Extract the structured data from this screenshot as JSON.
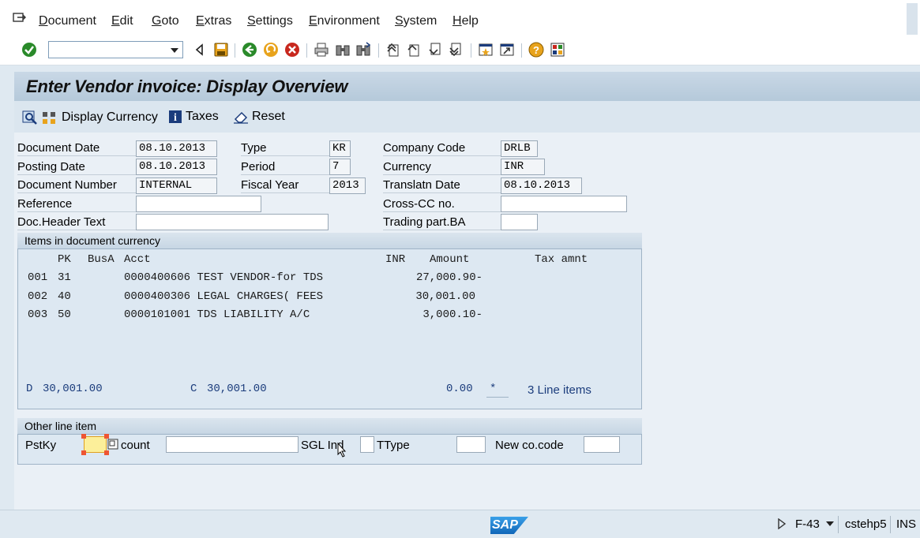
{
  "menu": [
    "Document",
    "Edit",
    "Goto",
    "Extras",
    "Settings",
    "Environment",
    "System",
    "Help"
  ],
  "title": "Enter Vendor invoice: Display Overview",
  "app_toolbar": {
    "display_currency": "Display Currency",
    "taxes": "Taxes",
    "reset": "Reset"
  },
  "header": {
    "document_date_label": "Document Date",
    "document_date": "08.10.2013",
    "posting_date_label": "Posting Date",
    "posting_date": "08.10.2013",
    "document_number_label": "Document Number",
    "document_number": "INTERNAL",
    "reference_label": "Reference",
    "reference": "",
    "doc_header_text_label": "Doc.Header Text",
    "doc_header_text": "",
    "type_label": "Type",
    "type": "KR",
    "period_label": "Period",
    "period": "7",
    "fiscal_year_label": "Fiscal Year",
    "fiscal_year": "2013",
    "company_code_label": "Company Code",
    "company_code": "DRLB",
    "currency_label": "Currency",
    "currency": "INR",
    "translatn_date_label": "Translatn Date",
    "translatn_date": "08.10.2013",
    "cross_cc_label": "Cross-CC no.",
    "cross_cc": "",
    "trading_part_label": "Trading part.BA",
    "trading_part": ""
  },
  "items": {
    "section_title": "Items in document currency",
    "col_pk": "PK",
    "col_busa": "BusA",
    "col_acct": "Acct",
    "col_inr": "INR",
    "col_amount": "Amount",
    "col_tax": "Tax amnt",
    "rows": [
      {
        "line": "001",
        "pk": "31",
        "text": "0000400606 TEST VENDOR-for TDS",
        "amount": "27,000.90-"
      },
      {
        "line": "002",
        "pk": "40",
        "text": "0000400306 LEGAL CHARGES( FEES",
        "amount": "30,001.00"
      },
      {
        "line": "003",
        "pk": "50",
        "text": "0000101001 TDS LIABILITY A/C",
        "amount": "3,000.10-"
      }
    ],
    "debit_label": "D",
    "debit": "30,001.00",
    "credit_label": "C",
    "credit": "30,001.00",
    "balance": "0.00",
    "balance_flag": "*",
    "line_items": "3 Line items"
  },
  "other": {
    "section_title": "Other line item",
    "pstky_label": "PstKy",
    "account_label": "count",
    "sgl_label": "SGL Ind",
    "ttype_label": "TType",
    "new_cocode_label": "New co.code"
  },
  "status": {
    "tcode": "F-43",
    "server": "cstehp5",
    "mode": "INS",
    "logo": "SAP"
  },
  "colors": {
    "accent_green": "#2a8a2a",
    "title_blue": "#b5c9da",
    "sap_blue": "#1a7fd0"
  }
}
